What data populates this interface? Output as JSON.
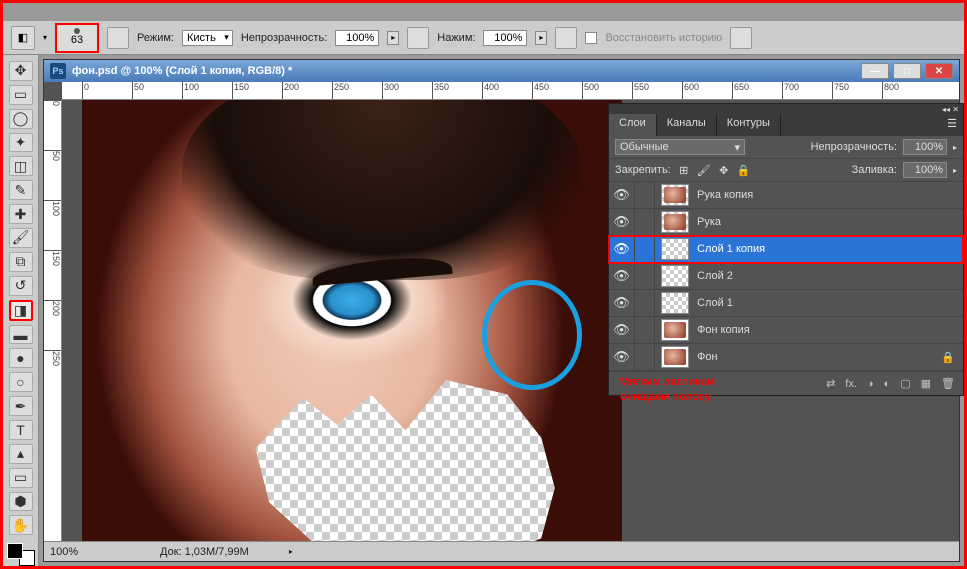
{
  "options": {
    "brush_size": "63",
    "mode_label": "Режим:",
    "mode_value": "Кисть",
    "opacity_label": "Непрозрачность:",
    "opacity_value": "100%",
    "flow_label": "Нажим:",
    "flow_value": "100%",
    "restore_label": "Восстановить историю"
  },
  "doc": {
    "title": "фон.psd @ 100% (Слой 1 копия, RGB/8) *",
    "zoom": "100%",
    "docinfo": "Док: 1,03M/7,99M",
    "ruler_ticks_h": [
      "0",
      "50",
      "100",
      "150",
      "200",
      "250",
      "300",
      "350",
      "400",
      "450",
      "500",
      "550",
      "600",
      "650",
      "700",
      "750",
      "800"
    ],
    "ruler_ticks_v": [
      "0",
      "50",
      "100",
      "150",
      "200",
      "250"
    ]
  },
  "panel": {
    "tabs": [
      "Слои",
      "Каналы",
      "Контуры"
    ],
    "blend_value": "Обычные",
    "opacity_label": "Непрозрачность:",
    "opacity_value": "100%",
    "lock_label": "Закрепить:",
    "fill_label": "Заливка:",
    "fill_value": "100%",
    "layers": [
      {
        "name": "Рука копия",
        "thumb": "trans-mini",
        "locked": false
      },
      {
        "name": "Рука",
        "thumb": "trans-mini",
        "locked": false
      },
      {
        "name": "Слой 1 копия",
        "thumb": "trans",
        "locked": false,
        "selected": true
      },
      {
        "name": "Слой 2",
        "thumb": "trans",
        "locked": false
      },
      {
        "name": "Слой 1",
        "thumb": "trans",
        "locked": false
      },
      {
        "name": "Фон копия",
        "thumb": "mini",
        "locked": false
      },
      {
        "name": "Фон",
        "thumb": "mini",
        "locked": true
      }
    ]
  },
  "annotation": {
    "line1": "Мягким ластиком",
    "line2": "очищаем полосу."
  }
}
